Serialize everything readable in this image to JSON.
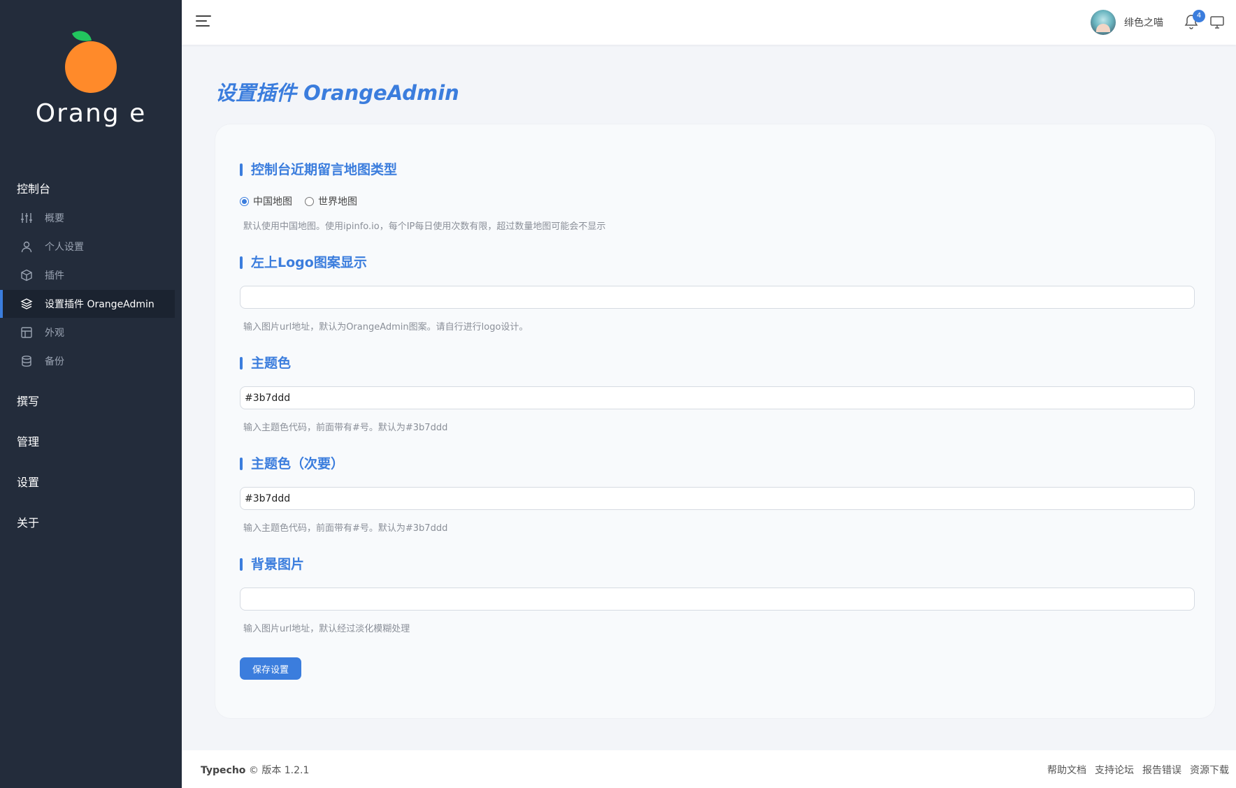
{
  "sidebar": {
    "logo_text": "Orang e",
    "groups": {
      "console": "控制台",
      "write": "撰写",
      "manage": "管理",
      "settings": "设置",
      "about": "关于"
    },
    "items": [
      {
        "label": "概要",
        "icon": "sliders-icon"
      },
      {
        "label": "个人设置",
        "icon": "user-icon"
      },
      {
        "label": "插件",
        "icon": "package-icon"
      },
      {
        "label": "设置插件 OrangeAdmin",
        "icon": "layers-icon",
        "active": true
      },
      {
        "label": "外观",
        "icon": "layout-icon"
      },
      {
        "label": "备份",
        "icon": "database-icon"
      }
    ]
  },
  "topbar": {
    "username": "绯色之喵",
    "notification_count": "4"
  },
  "page": {
    "title": "设置插件 OrangeAdmin"
  },
  "form": {
    "map_type": {
      "title": "控制台近期留言地图类型",
      "options": [
        "中国地图",
        "世界地图"
      ],
      "selected": "中国地图",
      "hint": "默认使用中国地图。使用ipinfo.io，每个IP每日使用次数有限，超过数量地图可能会不显示"
    },
    "logo": {
      "title": "左上Logo图案显示",
      "value": "",
      "hint": "输入图片url地址，默认为OrangeAdmin图案。请自行进行logo设计。"
    },
    "theme_color": {
      "title": "主题色",
      "value": "#3b7ddd",
      "hint": "输入主题色代码，前面带有#号。默认为#3b7ddd"
    },
    "theme_color_secondary": {
      "title": "主题色（次要）",
      "value": "#3b7ddd",
      "hint": "输入主题色代码，前面带有#号。默认为#3b7ddd"
    },
    "background": {
      "title": "背景图片",
      "value": "",
      "hint": "输入图片url地址，默认经过淡化模糊处理"
    },
    "save_label": "保存设置"
  },
  "footer": {
    "brand": "Typecho",
    "version": "© 版本 1.2.1",
    "links": [
      "帮助文档",
      "支持论坛",
      "报告错误",
      "资源下载"
    ]
  },
  "colors": {
    "accent": "#3b7ddd",
    "sidebar_bg": "#232c3b",
    "orange": "#ff8a2a",
    "leaf": "#22c55e"
  }
}
